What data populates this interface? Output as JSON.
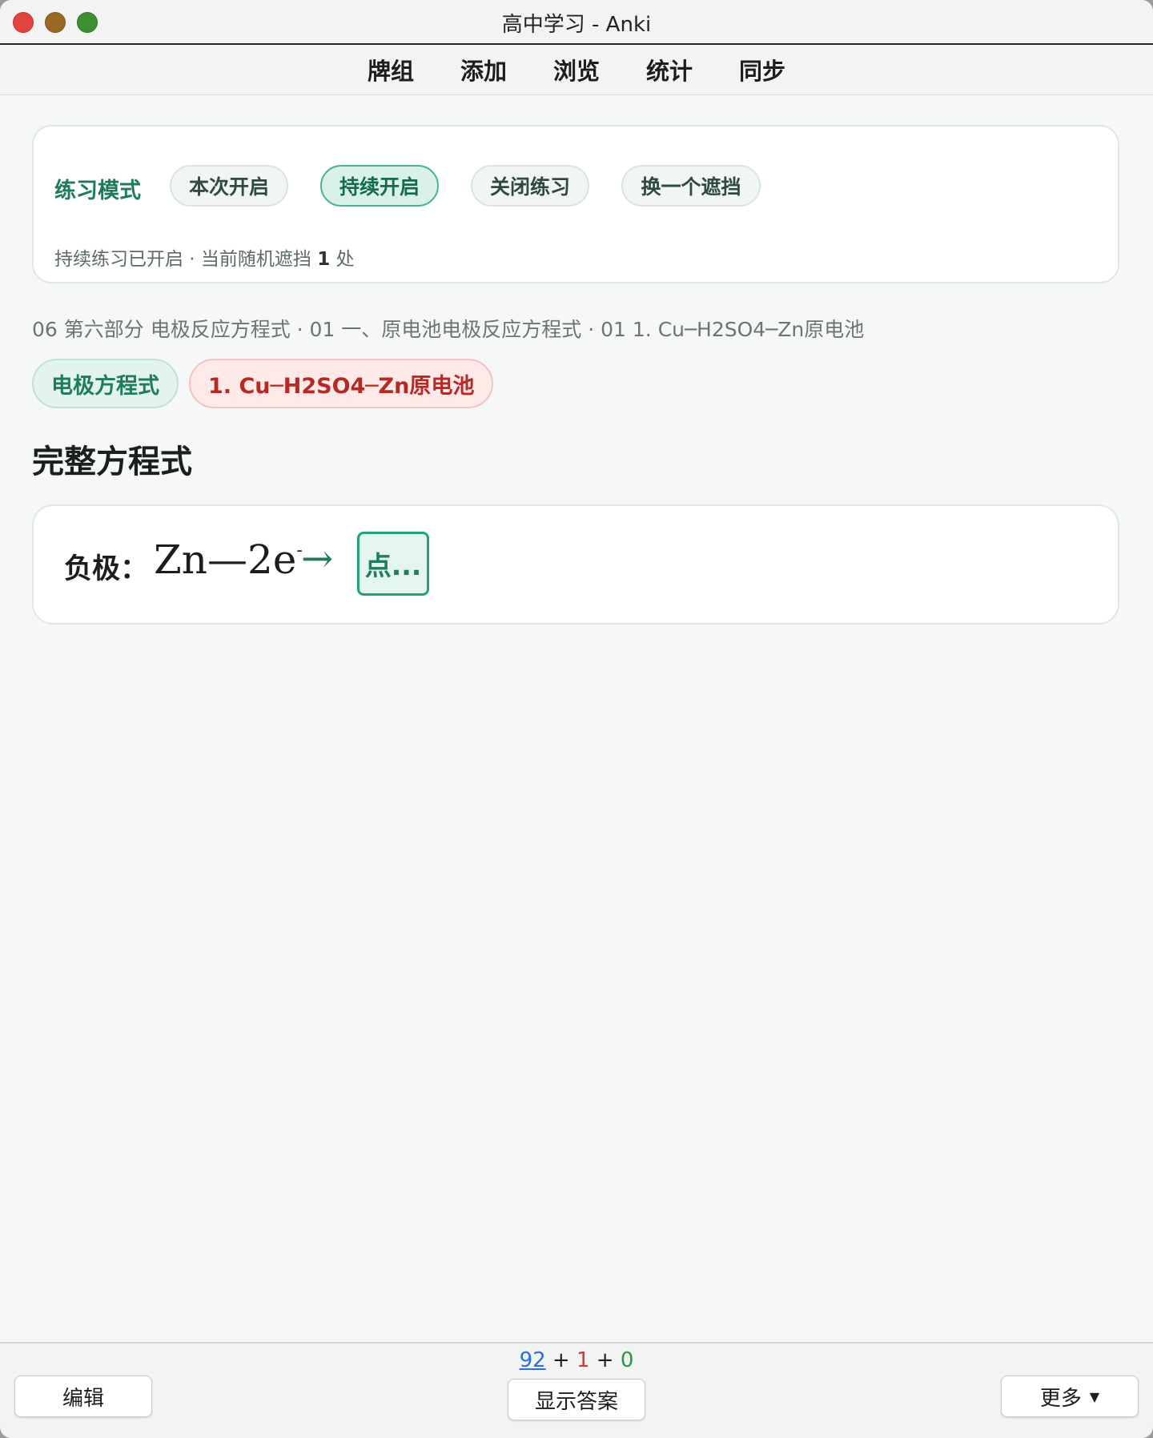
{
  "window": {
    "title": "高中学习 - Anki"
  },
  "toolbar": {
    "items": [
      "牌组",
      "添加",
      "浏览",
      "统计",
      "同步"
    ]
  },
  "practice": {
    "label": "练习模式",
    "chips": [
      "本次开启",
      "持续开启",
      "关闭练习",
      "换一个遮挡"
    ],
    "active_chip": "持续开启",
    "status_prefix": "持续练习已开启 · 当前随机遮挡 ",
    "status_count": "1",
    "status_suffix": " 处"
  },
  "card": {
    "breadcrumb": "06 第六部分 电极反应方程式 · 01 一、原电池电极反应方程式 · 01 1.  Cu─H2SO4─Zn原电池",
    "tags": [
      "电极方程式",
      "1.  Cu─H2SO4─Zn原电池"
    ],
    "section_title": "完整方程式",
    "equation": {
      "label": "负极：",
      "formula_main": "Zn—2e",
      "formula_sup": "-",
      "arrow": "→",
      "cloze_text": "点..."
    }
  },
  "bottom": {
    "edit_label": "编辑",
    "show_answer_label": "显示答案",
    "more_label": "更多",
    "counts": {
      "new": "92",
      "learning": "1",
      "review": "0",
      "sep": " + "
    },
    "colors": {
      "new": "#2d6fd6",
      "learning": "#d23a32",
      "review": "#259a42"
    }
  }
}
